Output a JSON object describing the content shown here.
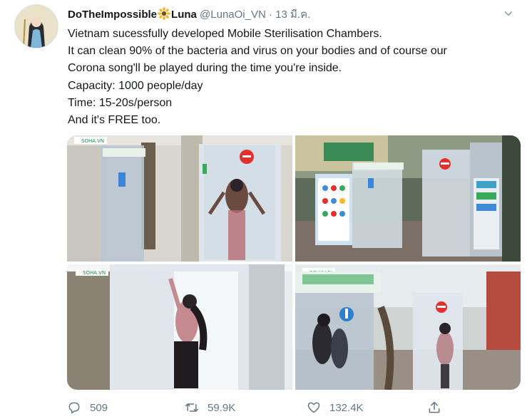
{
  "tweet": {
    "display_name": "DoTheImpossible",
    "display_name_suffix": "Luna",
    "handle": "@LunaOi_VN",
    "separator": "·",
    "date": "13 มี.ค.",
    "text_lines": [
      "Vietnam sucessfully developed Mobile Sterilisation Chambers.",
      "It can clean 90% of the bacteria and virus on your bodies and of course our",
      "Corona song'll be played during the time you're inside.",
      "Capacity: 1000 people/day",
      "Time: 15-20s/person",
      "And it's FREE too."
    ],
    "photo_watermarks": [
      "SOHA.VN",
      "SOHA.VN",
      "SOHA.VN"
    ],
    "stats": {
      "replies": "509",
      "retweets": "59.9K",
      "likes": "132.4K"
    }
  },
  "icons": {
    "avatar": "profile-avatar",
    "name_emoji": "sunflower-icon",
    "more": "chevron-down-icon",
    "reply": "reply-icon",
    "retweet": "retweet-icon",
    "like": "heart-icon",
    "share": "share-icon"
  },
  "colors": {
    "text": "#14171a",
    "secondary": "#657786",
    "chamber_sign_red": "#e0312f",
    "chamber_sign_blue": "#2f7fd0"
  }
}
